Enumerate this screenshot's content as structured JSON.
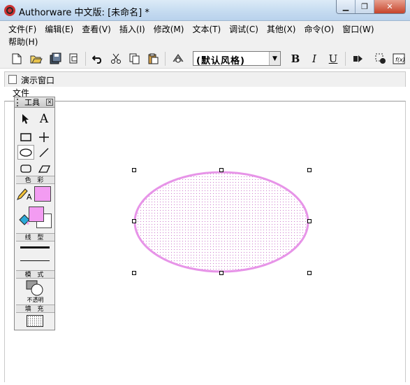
{
  "window": {
    "title": "Authorware 中文版: [未命名] *",
    "minimize_label": "▁",
    "maximize_label": "❐",
    "close_label": "✕"
  },
  "menu": {
    "row1": [
      "文件(F)",
      "编辑(E)",
      "查看(V)",
      "插入(I)",
      "修改(M)",
      "文本(T)",
      "调试(C)",
      "其他(X)",
      "命令(O)",
      "窗口(W)"
    ],
    "row2": [
      "帮助(H)"
    ]
  },
  "toolbar": {
    "style_value": "(默认风格)",
    "bold": "B",
    "italic": "I",
    "underline": "U",
    "icons": [
      "new-icon",
      "open-icon",
      "save-all-icon",
      "import-icon",
      "undo-icon",
      "cut-icon",
      "copy-icon",
      "paste-icon",
      "find-icon",
      "run-icon",
      "control-panel-icon",
      "functions-icon"
    ]
  },
  "document": {
    "title": "演示窗口",
    "sub_menu": "文件"
  },
  "palette": {
    "title": "工具",
    "color_label": "色 彩",
    "line_label": "线 型",
    "mode_label": "模 式",
    "mode_value": "不透明",
    "fill_label": "填 充"
  },
  "colors": {
    "ellipse_stroke": "#e695e8",
    "ellipse_fill_dots": "#d27fd6",
    "fill_swatch": "#f39cf2",
    "line_swatch": "#f39cf2"
  },
  "shape": {
    "type": "ellipse",
    "selected": true
  }
}
